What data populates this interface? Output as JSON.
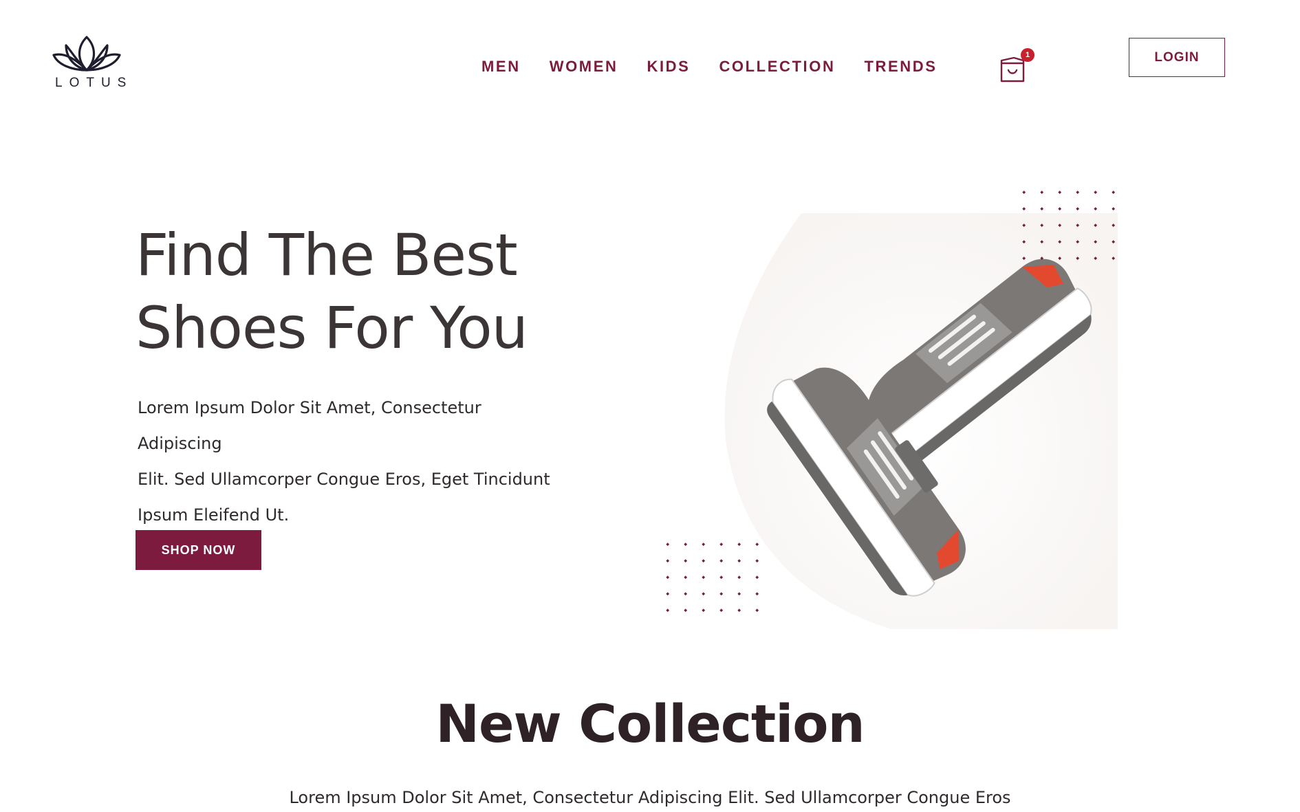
{
  "brand": {
    "name": "LOTUS",
    "logo_icon": "lotus-icon"
  },
  "nav": {
    "items": [
      {
        "label": "MEN"
      },
      {
        "label": "WOMEN"
      },
      {
        "label": "KIDS"
      },
      {
        "label": "COLLECTION"
      },
      {
        "label": "TRENDS"
      }
    ]
  },
  "cart": {
    "icon": "shopping-bag-icon",
    "count": "1"
  },
  "login": {
    "label": "LOGIN"
  },
  "hero": {
    "title_line1": "Find The Best",
    "title_line2": "Shoes For You",
    "desc_line1": "Lorem Ipsum Dolor Sit Amet, Consectetur Adipiscing",
    "desc_line2": "Elit. Sed Ullamcorper Congue Eros, Eget Tincidunt",
    "desc_line3": "Ipsum Eleifend Ut.",
    "cta_label": "SHOP NOW"
  },
  "collection": {
    "title": "New Collection",
    "desc": "Lorem Ipsum Dolor Sit Amet, Consectetur Adipiscing Elit. Sed Ullamcorper Congue Eros"
  },
  "colors": {
    "accent": "#7c1b3e",
    "badge": "#c8202d",
    "text": "#352e2f"
  }
}
